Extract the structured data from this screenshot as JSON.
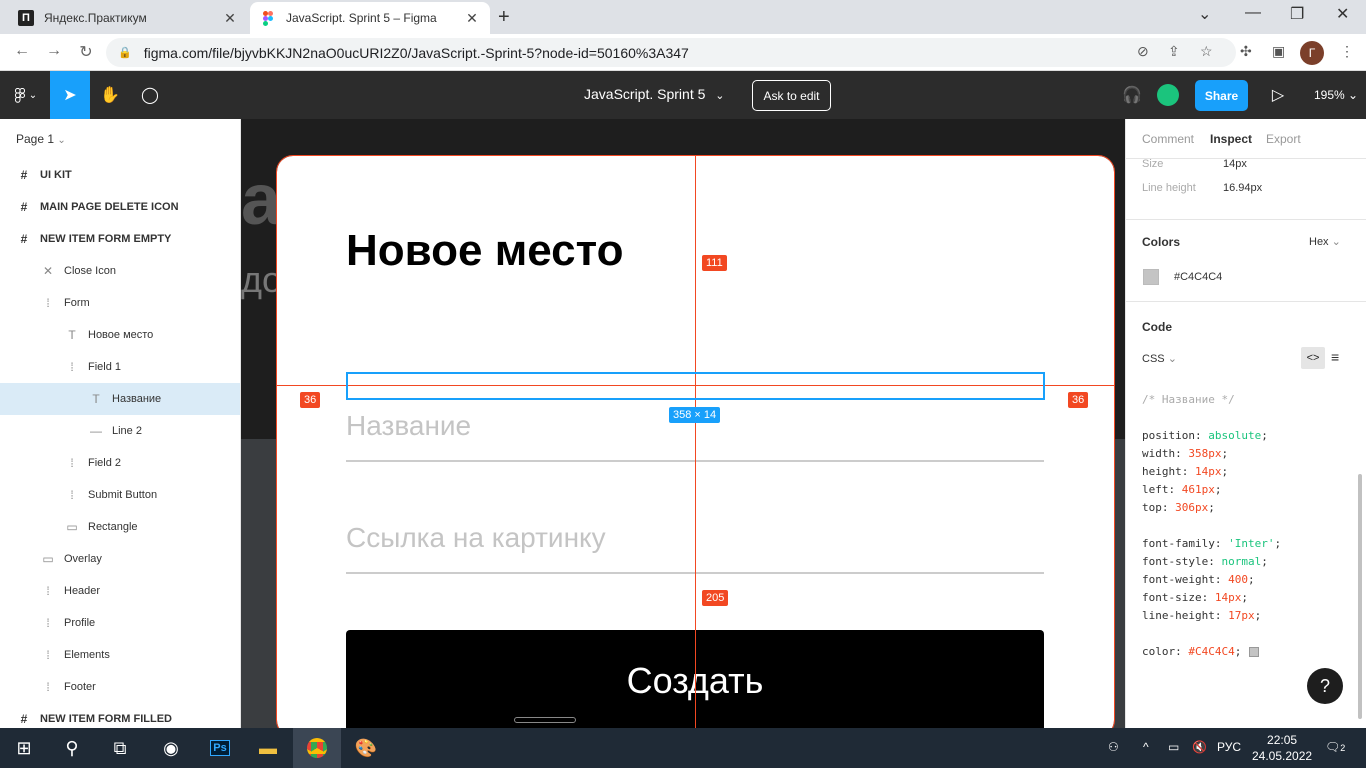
{
  "browser": {
    "tabs": [
      {
        "title": "Яндекс.Практикум",
        "favicon": "П"
      },
      {
        "title": "JavaScript. Sprint 5 – Figma",
        "favicon": "figma"
      }
    ],
    "url": "figma.com/file/bjyvbKKJN2naO0ucURI2Z0/JavaScript.-Sprint-5?node-id=50160%3A347",
    "profile_initial": "Г"
  },
  "toolbar": {
    "file_title": "JavaScript. Sprint 5",
    "ask_to_edit": "Ask to edit",
    "share": "Share",
    "zoom": "195%"
  },
  "layers": {
    "page": "Page 1",
    "items": [
      {
        "label": "UI KIT",
        "icon": "frame",
        "indent": 0
      },
      {
        "label": "MAIN PAGE DELETE ICON",
        "icon": "frame",
        "indent": 0
      },
      {
        "label": "NEW ITEM FORM EMPTY",
        "icon": "frame",
        "indent": 0
      },
      {
        "label": "Close Icon",
        "icon": "close",
        "indent": 1
      },
      {
        "label": "Form",
        "icon": "group",
        "indent": 1
      },
      {
        "label": "Новое место",
        "icon": "text",
        "indent": 2
      },
      {
        "label": "Field 1",
        "icon": "group",
        "indent": 2
      },
      {
        "label": "Название",
        "icon": "text",
        "indent": 3,
        "selected": true
      },
      {
        "label": "Line 2",
        "icon": "line",
        "indent": 3
      },
      {
        "label": "Field 2",
        "icon": "group",
        "indent": 2
      },
      {
        "label": "Submit Button",
        "icon": "group",
        "indent": 2
      },
      {
        "label": "Rectangle",
        "icon": "rect",
        "indent": 2
      },
      {
        "label": "Overlay",
        "icon": "rect",
        "indent": 1
      },
      {
        "label": "Header",
        "icon": "group",
        "indent": 1
      },
      {
        "label": "Profile",
        "icon": "group",
        "indent": 1
      },
      {
        "label": "Elements",
        "icon": "group",
        "indent": 1
      },
      {
        "label": "Footer",
        "icon": "group",
        "indent": 1
      },
      {
        "label": "NEW ITEM FORM FILLED",
        "icon": "frame",
        "indent": 0
      }
    ]
  },
  "canvas": {
    "modal_title": "Новое место",
    "field1_placeholder": "Название",
    "field2_placeholder": "Ссылка на картинку",
    "submit_label": "Создать",
    "measure_top": "111",
    "measure_left": "36",
    "measure_right": "36",
    "measure_bottom": "205",
    "selection_size": "358 × 14",
    "bg_text1": "ан",
    "bg_text2": "до"
  },
  "inspect": {
    "tabs": [
      "Comment",
      "Inspect",
      "Export"
    ],
    "size_label": "Size",
    "size_value": "14px",
    "line_height_label": "Line height",
    "line_height_value": "16.94px",
    "colors_title": "Colors",
    "color_format": "Hex",
    "color_value": "#C4C4C4",
    "code_title": "Code",
    "code_lang": "CSS",
    "code_comment": "/* Название */",
    "code_lines": [
      {
        "prop": "position",
        "val": "absolute",
        "type": "v"
      },
      {
        "prop": "width",
        "val": "358px",
        "type": "n"
      },
      {
        "prop": "height",
        "val": "14px",
        "type": "n"
      },
      {
        "prop": "left",
        "val": "461px",
        "type": "n"
      },
      {
        "prop": "top",
        "val": "306px",
        "type": "n"
      },
      null,
      {
        "prop": "font-family",
        "val": "'Inter'",
        "type": "v"
      },
      {
        "prop": "font-style",
        "val": "normal",
        "type": "v"
      },
      {
        "prop": "font-weight",
        "val": "400",
        "type": "n"
      },
      {
        "prop": "font-size",
        "val": "14px",
        "type": "n"
      },
      {
        "prop": "line-height",
        "val": "17px",
        "type": "n"
      },
      null,
      {
        "prop": "color",
        "val": "#C4C4C4",
        "type": "n"
      }
    ],
    "help": "?"
  },
  "taskbar": {
    "lang": "РУС",
    "time": "22:05",
    "date": "24.05.2022",
    "notifications": "2"
  },
  "colors": {
    "figma_blue": "#18a0fb",
    "measure_red": "#f24822",
    "placeholder_gray": "#C4C4C4"
  }
}
